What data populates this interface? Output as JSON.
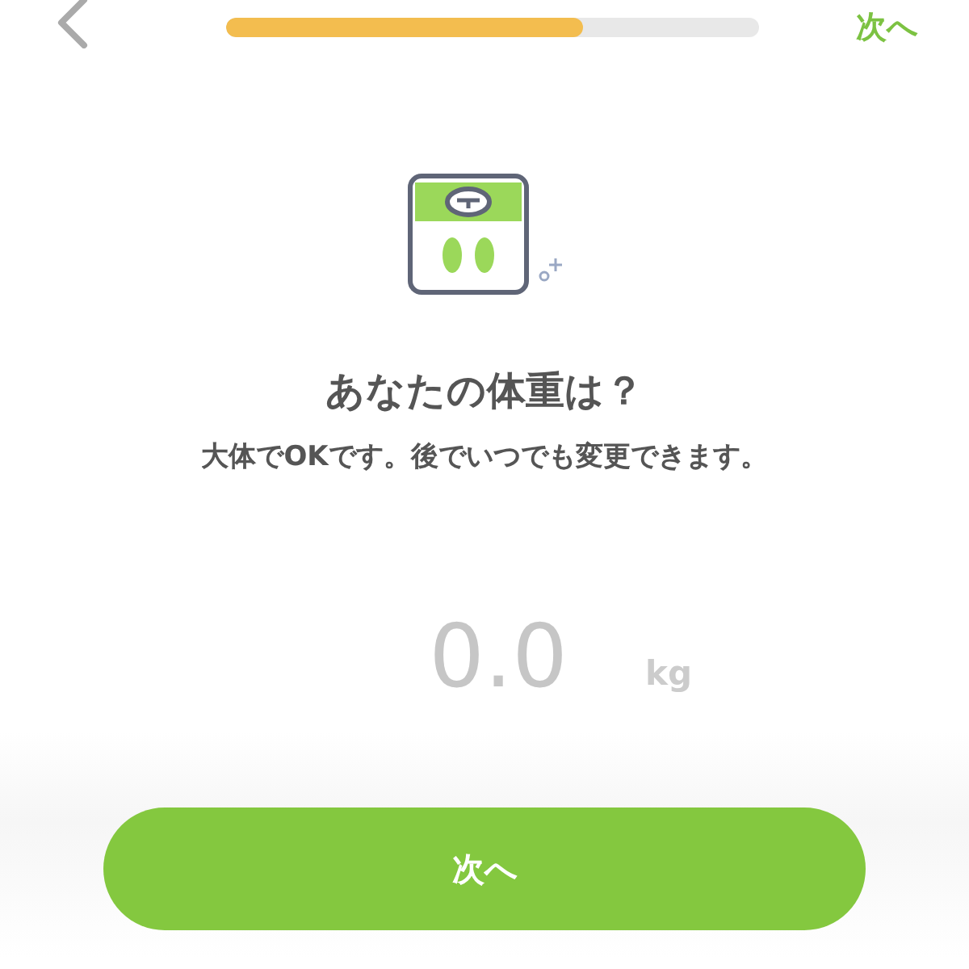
{
  "header": {
    "progress": {
      "level": 0.67
    },
    "next_link": "次へ"
  },
  "question": {
    "title": "あなたの体重は？",
    "subtitle": "大体でOKです。後でいつでも変更できます。"
  },
  "weight_field": {
    "placeholder": "0.0",
    "unit": "kg"
  },
  "next_button": "次へ"
}
